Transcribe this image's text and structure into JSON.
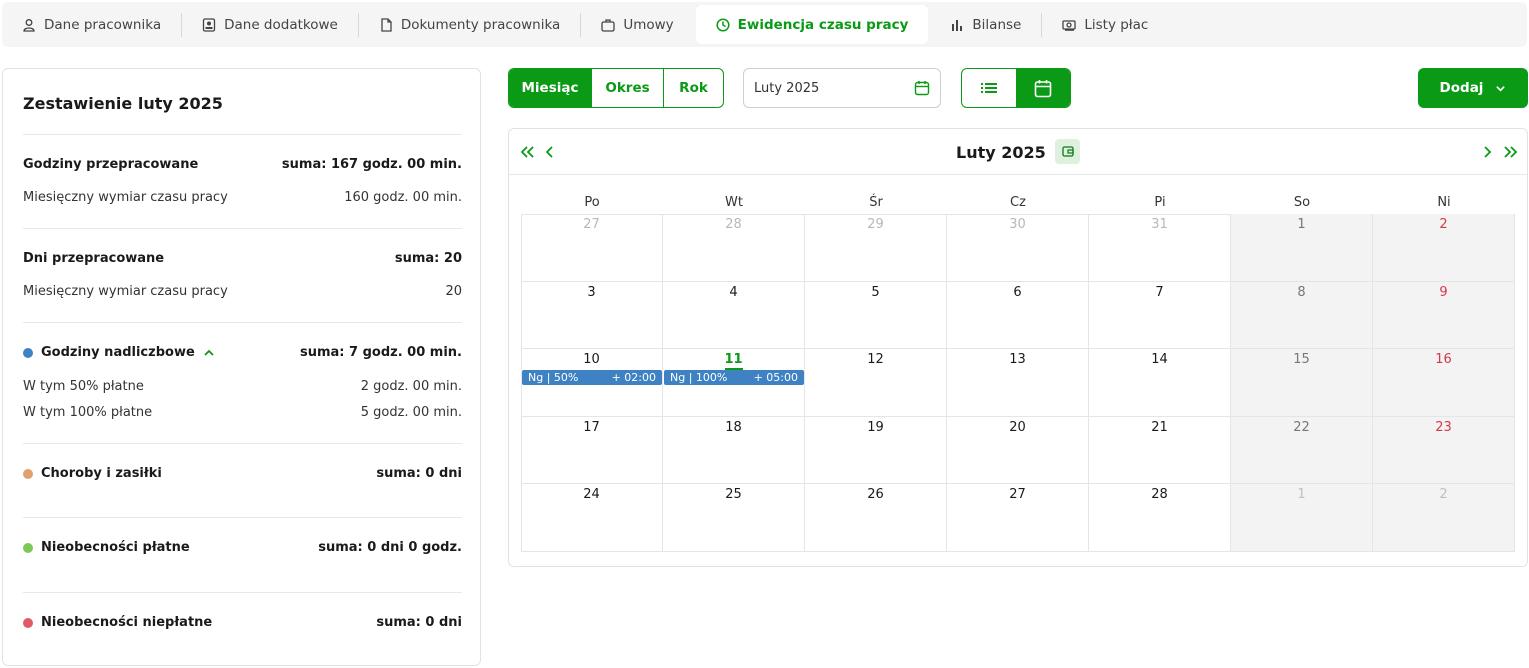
{
  "tabs": [
    {
      "label": "Dane pracownika",
      "icon": "user-icon"
    },
    {
      "label": "Dane dodatkowe",
      "icon": "id-card-icon"
    },
    {
      "label": "Dokumenty pracownika",
      "icon": "document-icon"
    },
    {
      "label": "Umowy",
      "icon": "briefcase-icon"
    },
    {
      "label": "Ewidencja czasu pracy",
      "icon": "clock-icon",
      "active": true
    },
    {
      "label": "Bilanse",
      "icon": "bar-chart-icon"
    },
    {
      "label": "Listy płac",
      "icon": "money-icon"
    }
  ],
  "summary": {
    "title": "Zestawienie luty 2025",
    "worked_hours": {
      "label": "Godziny przepracowane",
      "value": "suma: 167 godz. 00 min."
    },
    "monthly_norm_hours": {
      "label": "Miesięczny wymiar czasu pracy",
      "value": "160 godz. 00 min."
    },
    "worked_days": {
      "label": "Dni przepracowane",
      "value": "suma: 20"
    },
    "monthly_norm_days": {
      "label": "Miesięczny wymiar czasu pracy",
      "value": "20"
    },
    "overtime": {
      "label": "Godziny nadliczbowe",
      "value": "suma: 7 godz. 00 min.",
      "color": "#3f82c4"
    },
    "overtime_50": {
      "label": "W tym 50% płatne",
      "value": "2 godz. 00 min."
    },
    "overtime_100": {
      "label": "W tym 100% płatne",
      "value": "5 godz. 00 min."
    },
    "sickness": {
      "label": "Choroby i zasiłki",
      "value": "suma: 0 dni",
      "color": "#e0a070"
    },
    "paid_absence": {
      "label": "Nieobecności płatne",
      "value": "suma: 0 dni 0 godz.",
      "color": "#7ac95a"
    },
    "unpaid_absence": {
      "label": "Nieobecności niepłatne",
      "value": "suma: 0 dni",
      "color": "#e05a68"
    }
  },
  "toolbar": {
    "modes": [
      "Miesiąc",
      "Okres",
      "Rok"
    ],
    "active_mode": "Miesiąc",
    "date_value": "Luty 2025",
    "add_label": "Dodaj"
  },
  "calendar": {
    "title": "Luty 2025",
    "weekdays": [
      "Po",
      "Wt",
      "Śr",
      "Cz",
      "Pi",
      "So",
      "Ni"
    ],
    "weeks": [
      [
        {
          "d": "27",
          "o": true
        },
        {
          "d": "28",
          "o": true
        },
        {
          "d": "29",
          "o": true
        },
        {
          "d": "30",
          "o": true
        },
        {
          "d": "31",
          "o": true
        },
        {
          "d": "1",
          "o": false
        },
        {
          "d": "2",
          "o": false
        }
      ],
      [
        {
          "d": "3"
        },
        {
          "d": "4"
        },
        {
          "d": "5"
        },
        {
          "d": "6"
        },
        {
          "d": "7"
        },
        {
          "d": "8"
        },
        {
          "d": "9"
        }
      ],
      [
        {
          "d": "10"
        },
        {
          "d": "11",
          "today": true
        },
        {
          "d": "12"
        },
        {
          "d": "13"
        },
        {
          "d": "14"
        },
        {
          "d": "15"
        },
        {
          "d": "16"
        }
      ],
      [
        {
          "d": "17"
        },
        {
          "d": "18"
        },
        {
          "d": "19"
        },
        {
          "d": "20"
        },
        {
          "d": "21"
        },
        {
          "d": "22"
        },
        {
          "d": "23"
        }
      ],
      [
        {
          "d": "24"
        },
        {
          "d": "25"
        },
        {
          "d": "26"
        },
        {
          "d": "27"
        },
        {
          "d": "28"
        },
        {
          "d": "1",
          "o": true
        },
        {
          "d": "2",
          "o": true
        }
      ]
    ],
    "events": [
      {
        "week": 2,
        "day": 0,
        "label": "Ng | 50%",
        "value": "+ 02:00",
        "color": "#3f82c4"
      },
      {
        "week": 2,
        "day": 1,
        "label": "Ng | 100%",
        "value": "+ 05:00",
        "color": "#3f82c4"
      }
    ]
  }
}
